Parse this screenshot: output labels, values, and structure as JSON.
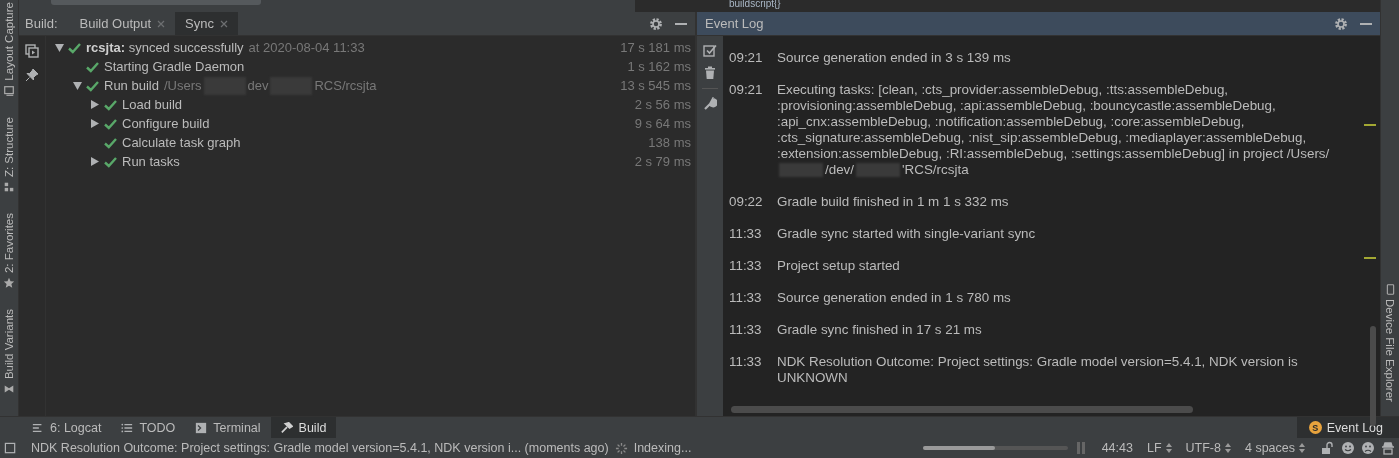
{
  "editor_strip": {
    "text": "buildscript{}"
  },
  "left_toolbar": [
    {
      "label": "Layout Capture"
    },
    {
      "label": "Z: Structure"
    },
    {
      "label": "2: Favorites"
    },
    {
      "label": "Build Variants"
    }
  ],
  "build_panel": {
    "title": "Build:",
    "tabs": [
      {
        "label": "Build Output",
        "selected": false
      },
      {
        "label": "Sync",
        "selected": true
      }
    ],
    "tree": [
      {
        "name": "rcsjta:",
        "text": "synced successfully",
        "detail": [
          "at 2020-08-04 11:33"
        ],
        "duration": "17 s 181 ms",
        "expanded": true,
        "children": [
          {
            "text": "Starting Gradle Daemon",
            "duration": "1 s 162 ms"
          },
          {
            "text": "Run build",
            "detail": [
              "/Users",
              "dev",
              "RCS/rcsjta"
            ],
            "duration": "13 s 545 ms",
            "expanded": true,
            "children": [
              {
                "text": "Load build",
                "duration": "2 s 56 ms",
                "expanded": false
              },
              {
                "text": "Configure build",
                "duration": "9 s 64 ms",
                "expanded": false
              },
              {
                "text": "Calculate task graph",
                "duration": "138 ms"
              },
              {
                "text": "Run tasks",
                "duration": "2 s 79 ms",
                "expanded": false
              }
            ]
          }
        ]
      }
    ]
  },
  "event_log": {
    "title": "Event Log",
    "entries": [
      {
        "time": "09:21",
        "message": [
          "Source generation ended in 3 s 139 ms"
        ]
      },
      {
        "time": "09:21",
        "message": [
          "Executing tasks: [clean, :cts_provider:assembleDebug, :tts:assembleDebug, :provisioning:assembleDebug, :api:assembleDebug, :bouncycastle:assembleDebug, :api_cnx:assembleDebug, :notification:assembleDebug, :core:assembleDebug, :cts_signature:assembleDebug, :nist_sip:assembleDebug, :mediaplayer:assembleDebug, :extension:assembleDebug, :RI:assembleDebug, :settings:assembleDebug] in project /Users/",
          "/dev/",
          "'RCS/rcsjta"
        ]
      },
      {
        "time": "09:22",
        "message": [
          "Gradle build finished in 1 m 1 s 332 ms"
        ]
      },
      {
        "time": "11:33",
        "message": [
          "Gradle sync started with single-variant sync"
        ]
      },
      {
        "time": "11:33",
        "message": [
          "Project setup started"
        ]
      },
      {
        "time": "11:33",
        "message": [
          "Source generation ended in 1 s 780 ms"
        ]
      },
      {
        "time": "11:33",
        "message": [
          "Gradle sync finished in 17 s 21 ms"
        ]
      },
      {
        "time": "11:33",
        "message": [
          "NDK Resolution Outcome: Project settings: Gradle model version=5.4.1, NDK version is UNKNOWN"
        ]
      }
    ]
  },
  "right_toolbar": [
    {
      "label": "Device File Explorer"
    }
  ],
  "bottom_tabs": [
    {
      "label": "6: Logcat",
      "selected": false
    },
    {
      "label": "TODO",
      "selected": false
    },
    {
      "label": "Terminal",
      "selected": false
    },
    {
      "label": "Build",
      "selected": true
    }
  ],
  "event_log_button": {
    "badge": "S",
    "label": "Event Log"
  },
  "status_bar": {
    "message": "NDK Resolution Outcome: Project settings: Gradle model version=5.4.1, NDK version i... (moments ago)",
    "task": "Indexing...",
    "progress": {
      "level": 0.5
    },
    "position": "44:43",
    "line_separator": "LF",
    "encoding": "UTF-8",
    "indent": "4 spaces"
  }
}
